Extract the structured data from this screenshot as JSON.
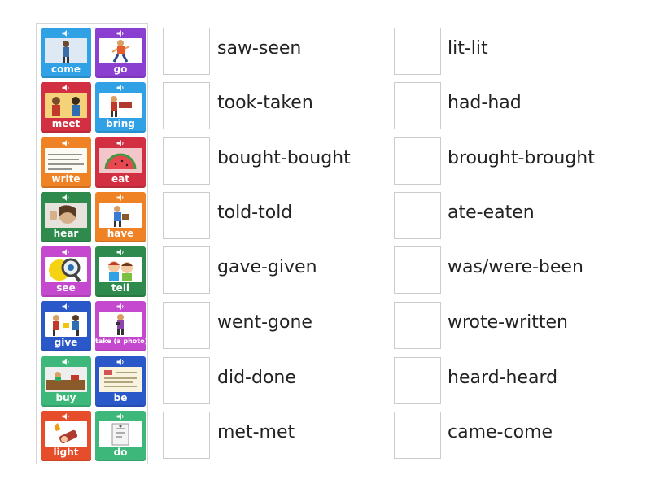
{
  "tiles": [
    {
      "label": "come",
      "color": "#2fa1e4",
      "icon": "person-walking-icon"
    },
    {
      "label": "go",
      "color": "#8b3fd1",
      "icon": "person-running-icon"
    },
    {
      "label": "meet",
      "color": "#d23042",
      "icon": "two-people-talking-icon"
    },
    {
      "label": "bring",
      "color": "#2fa1e4",
      "icon": "person-carrying-icon"
    },
    {
      "label": "write",
      "color": "#f08226",
      "icon": "handwriting-note-icon"
    },
    {
      "label": "eat",
      "color": "#d23042",
      "icon": "watermelon-icon"
    },
    {
      "label": "hear",
      "color": "#2e8a4d",
      "icon": "ear-listening-icon"
    },
    {
      "label": "have",
      "color": "#f08226",
      "icon": "person-holding-item-icon"
    },
    {
      "label": "see",
      "color": "#c549cf",
      "icon": "magnifier-eye-icon"
    },
    {
      "label": "tell",
      "color": "#2e8a4d",
      "icon": "children-whispering-icon"
    },
    {
      "label": "give",
      "color": "#2b58c9",
      "icon": "person-giving-icon"
    },
    {
      "label": "take (a photo)",
      "color": "#c549cf",
      "icon": "camera-person-icon"
    },
    {
      "label": "buy",
      "color": "#3db87a",
      "icon": "shop-counter-icon"
    },
    {
      "label": "be",
      "color": "#2b58c9",
      "icon": "document-list-icon"
    },
    {
      "label": "light",
      "color": "#e64d2a",
      "icon": "lighter-flame-icon"
    },
    {
      "label": "do",
      "color": "#3db87a",
      "icon": "paper-task-icon"
    }
  ],
  "targets_left": [
    "saw-seen",
    "took-taken",
    "bought-bought",
    "told-told",
    "gave-given",
    "went-gone",
    "did-done",
    "met-met"
  ],
  "targets_right": [
    "lit-lit",
    "had-had",
    "brought-brought",
    "ate-eaten",
    "was/were-been",
    "wrote-written",
    "heard-heard",
    "came-come"
  ]
}
